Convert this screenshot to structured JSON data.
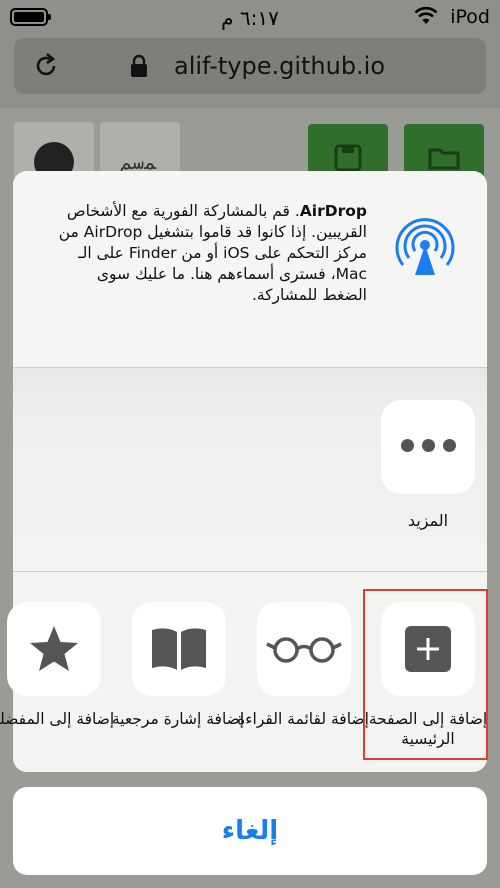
{
  "status_bar": {
    "time": "٦:١٧ م",
    "carrier": "iPod"
  },
  "address_bar": {
    "url": "alif-type.github.io"
  },
  "background": {
    "glyph": "ﻤﺳﻢ"
  },
  "airdrop": {
    "title": "AirDrop",
    "description": ". قم بالمشاركة الفورية مع الأشخاص القريبين. إذا كانوا قد قاموا بتشغيل AirDrop من مركز التحكم على iOS أو من Finder على الـ Mac، فسترى أسماءهم هنا. ما عليك سوى الضغط للمشاركة."
  },
  "actions": {
    "more_label": "المزيد"
  },
  "apps": [
    {
      "label": "إضافة إلى الصفحة الرئيسية",
      "icon": "add-square-icon"
    },
    {
      "label": "إضافة لقائمة القراءة",
      "icon": "glasses-icon"
    },
    {
      "label": "إضافة إشارة مرجعية",
      "icon": "book-icon"
    },
    {
      "label": "إضافة إلى المفضلة",
      "icon": "star-icon"
    }
  ],
  "cancel_label": "إلغاء",
  "colors": {
    "accent": "#1a7ef2",
    "highlight": "#e63b2e",
    "icon_gray": "#555555"
  }
}
